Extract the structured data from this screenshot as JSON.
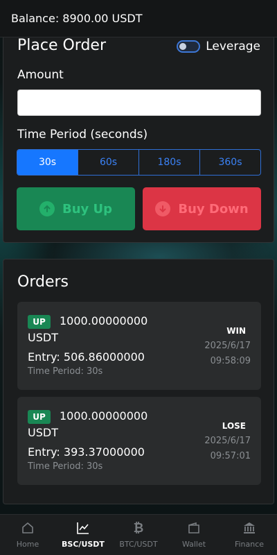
{
  "header": {
    "balance": "Balance: 8900.00 USDT"
  },
  "place_order": {
    "title": "Place Order",
    "leverage_label": "Leverage",
    "leverage_on": false,
    "amount_label": "Amount",
    "amount_value": "",
    "period_label": "Time Period (seconds)",
    "periods": [
      "30s",
      "60s",
      "180s",
      "360s"
    ],
    "selected_period": "30s",
    "buy_up_label": "Buy Up",
    "buy_down_label": "Buy Down",
    "colors": {
      "buy_up": "#198754",
      "buy_down": "#dc3545",
      "accent": "#1677ff"
    }
  },
  "orders": {
    "title": "Orders",
    "items": [
      {
        "direction": "UP",
        "amount": "1000.00000000",
        "unit": "USDT",
        "entry": "Entry: 506.86000000",
        "time_period": "Time Period: 30s",
        "result": "WIN",
        "date": "2025/6/17",
        "time": "09:58:09"
      },
      {
        "direction": "UP",
        "amount": "1000.00000000",
        "unit": "USDT",
        "entry": "Entry: 393.37000000",
        "time_period": "Time Period: 30s",
        "result": "LOSE",
        "date": "2025/6/17",
        "time": "09:57:01"
      }
    ]
  },
  "nav": {
    "items": [
      {
        "label": "Home",
        "icon": "home-icon"
      },
      {
        "label": "BSC/USDT",
        "icon": "chart-line-icon",
        "active": true
      },
      {
        "label": "BTC/USDT",
        "icon": "bitcoin-icon"
      },
      {
        "label": "Wallet",
        "icon": "wallet-icon"
      },
      {
        "label": "Finance",
        "icon": "bank-icon"
      }
    ]
  }
}
